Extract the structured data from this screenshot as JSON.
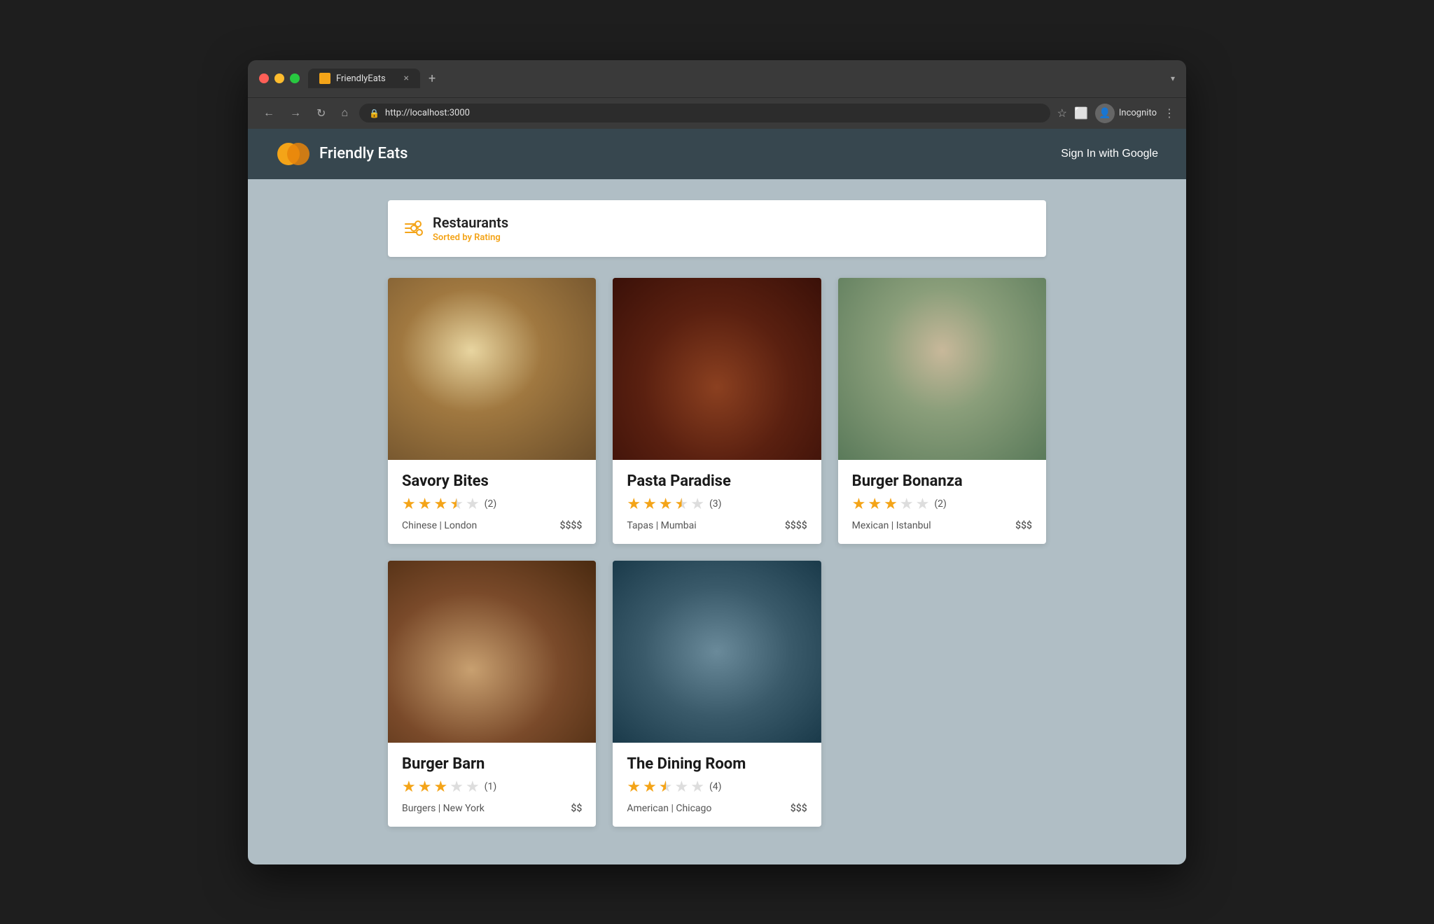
{
  "browser": {
    "tab_label": "FriendlyEats",
    "url": "http://localhost:3000",
    "new_tab_symbol": "+",
    "dropdown_symbol": "▾",
    "back_symbol": "←",
    "forward_symbol": "→",
    "refresh_symbol": "↻",
    "home_symbol": "⌂",
    "star_symbol": "☆",
    "menu_symbol": "⋮",
    "incognito_label": "Incognito",
    "close_symbol": "×"
  },
  "header": {
    "app_title": "Friendly Eats",
    "sign_in_label": "Sign In with Google"
  },
  "restaurants_panel": {
    "title": "Restaurants",
    "subtitle": "Sorted by Rating"
  },
  "cards": [
    {
      "id": 1,
      "name": "Savory Bites",
      "stars": 3.5,
      "full_stars": 3,
      "half_star": true,
      "empty_stars": 1,
      "review_count": "(2)",
      "cuisine": "Chinese",
      "city": "London",
      "price": "$$$$",
      "img_class": "food-img-1"
    },
    {
      "id": 2,
      "name": "Pasta Paradise",
      "stars": 3.5,
      "full_stars": 3,
      "half_star": true,
      "empty_stars": 1,
      "review_count": "(3)",
      "cuisine": "Tapas",
      "city": "Mumbai",
      "price": "$$$$",
      "img_class": "food-img-2"
    },
    {
      "id": 3,
      "name": "Burger Bonanza",
      "stars": 3.0,
      "full_stars": 3,
      "half_star": false,
      "empty_stars": 2,
      "review_count": "(2)",
      "cuisine": "Mexican",
      "city": "Istanbul",
      "price": "$$$",
      "img_class": "food-img-3"
    },
    {
      "id": 4,
      "name": "Burger Barn",
      "stars": 3.0,
      "full_stars": 3,
      "half_star": false,
      "empty_stars": 2,
      "review_count": "(1)",
      "cuisine": "Burgers",
      "city": "New York",
      "price": "$$",
      "img_class": "food-img-4"
    },
    {
      "id": 5,
      "name": "The Dining Room",
      "stars": 2.5,
      "full_stars": 2,
      "half_star": true,
      "empty_stars": 2,
      "review_count": "(4)",
      "cuisine": "American",
      "city": "Chicago",
      "price": "$$$",
      "img_class": "food-img-5"
    }
  ]
}
